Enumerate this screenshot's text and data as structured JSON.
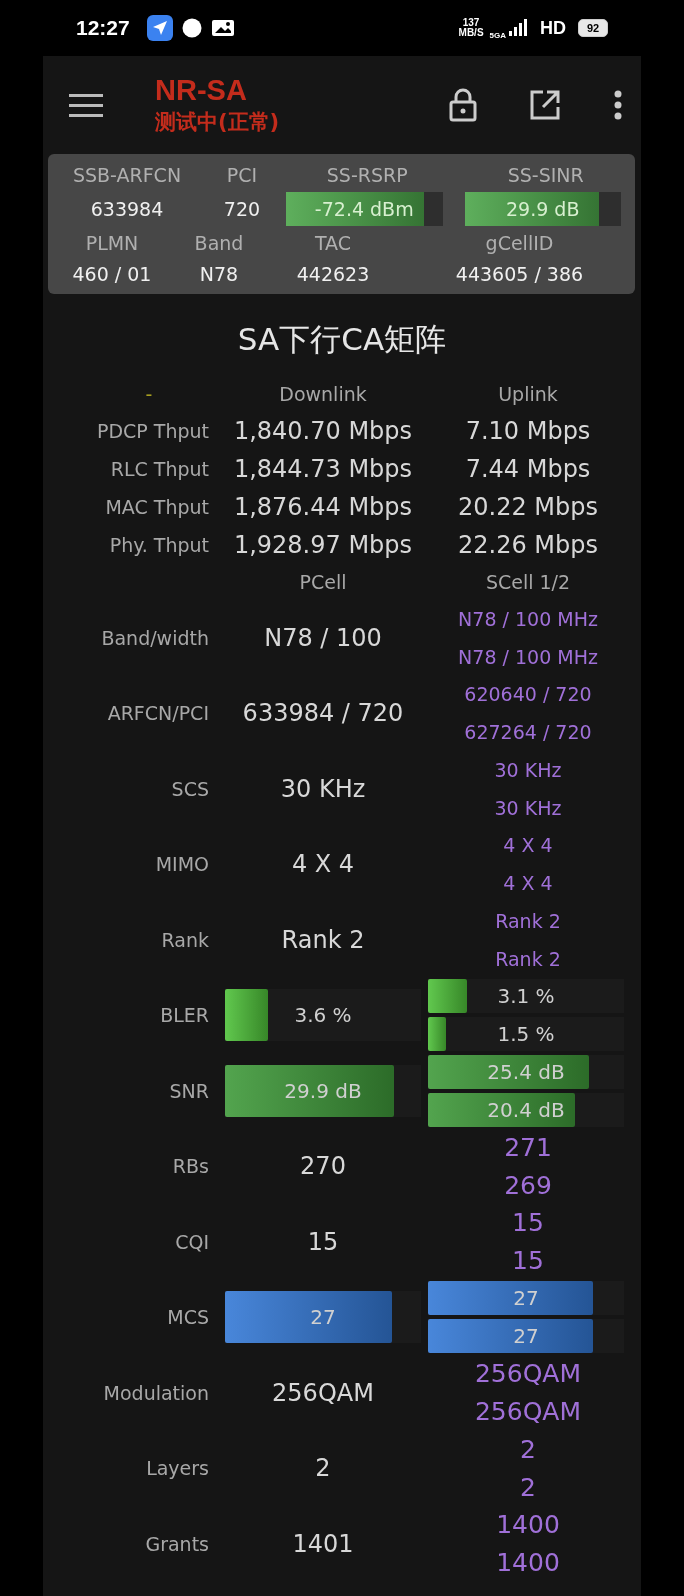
{
  "status_bar": {
    "time": "12:27",
    "net_speed": "137",
    "net_unit": "MB/S",
    "network": "5GA",
    "hd": "HD",
    "battery": "92"
  },
  "toolbar": {
    "title": "NR-SA",
    "subtitle": "测试中(正常)"
  },
  "serving": {
    "top": [
      {
        "label": "SSB-ARFCN",
        "value": "633984",
        "kind": "text"
      },
      {
        "label": "PCI",
        "value": "720",
        "kind": "text"
      },
      {
        "label": "SS-RSRP",
        "value": "-72.4 dBm",
        "kind": "meter",
        "level": 0.88
      },
      {
        "label": "SS-SINR",
        "value": "29.9 dB",
        "kind": "meter",
        "level": 0.86
      }
    ],
    "bottom": [
      {
        "label": "PLMN",
        "value": "460 / 01"
      },
      {
        "label": "Band",
        "value": "N78"
      },
      {
        "label": "TAC",
        "value": "442623"
      },
      {
        "label": "gCellID",
        "value": "443605 / 386"
      }
    ]
  },
  "ca_title": "SA下行CA矩阵",
  "throughput": {
    "corner": "-",
    "columns": [
      "Downlink",
      "Uplink"
    ],
    "rows": [
      {
        "label": "PDCP Thput",
        "downlink": "1,840.70 Mbps",
        "uplink": "7.10 Mbps"
      },
      {
        "label": "RLC Thput",
        "downlink": "1,844.73 Mbps",
        "uplink": "7.44 Mbps"
      },
      {
        "label": "MAC Thput",
        "downlink": "1,876.44 Mbps",
        "uplink": "20.22 Mbps"
      },
      {
        "label": "Phy. Thput",
        "downlink": "1,928.97 Mbps",
        "uplink": "22.26 Mbps"
      }
    ]
  },
  "cells": {
    "columns": [
      "PCell",
      "SCell 1/2"
    ],
    "rows": [
      {
        "label": "Band/width",
        "kind": "info",
        "pcell": {
          "value": "N78 / 100"
        },
        "scells": [
          {
            "value": "N78 / 100 MHz"
          },
          {
            "value": "N78 / 100 MHz"
          }
        ]
      },
      {
        "label": "ARFCN/PCI",
        "kind": "info",
        "pcell": {
          "value": "633984 / 720"
        },
        "scells": [
          {
            "value": "620640 / 720"
          },
          {
            "value": "627264 / 720"
          }
        ]
      },
      {
        "label": "SCS",
        "kind": "info",
        "pcell": {
          "value": "30 KHz"
        },
        "scells": [
          {
            "value": "30 KHz"
          },
          {
            "value": "30 KHz"
          }
        ]
      },
      {
        "label": "MIMO",
        "kind": "info",
        "pcell": {
          "value": "4 X 4"
        },
        "scells": [
          {
            "value": "4 X 4"
          },
          {
            "value": "4 X 4"
          }
        ]
      },
      {
        "label": "Rank",
        "kind": "info",
        "pcell": {
          "value": "Rank 2"
        },
        "scells": [
          {
            "value": "Rank 2"
          },
          {
            "value": "Rank 2"
          }
        ]
      },
      {
        "label": "BLER",
        "kind": "meter",
        "color": "#4fc23a",
        "pcell": {
          "value": "3.6 %",
          "level": 0.22
        },
        "scells": [
          {
            "value": "3.1 %",
            "level": 0.2
          },
          {
            "value": "1.5 %",
            "level": 0.09
          }
        ]
      },
      {
        "label": "SNR",
        "kind": "meter",
        "color": "#3f9a3a",
        "pcell": {
          "value": "29.9 dB",
          "level": 0.86
        },
        "scells": [
          {
            "value": "25.4 dB",
            "level": 0.82
          },
          {
            "value": "20.4 dB",
            "level": 0.75
          }
        ]
      },
      {
        "label": "RBs",
        "kind": "stat",
        "pcell": {
          "value": "270"
        },
        "scells": [
          {
            "value": "271"
          },
          {
            "value": "269"
          }
        ]
      },
      {
        "label": "CQI",
        "kind": "stat",
        "pcell": {
          "value": "15"
        },
        "scells": [
          {
            "value": "15"
          },
          {
            "value": "15"
          }
        ]
      },
      {
        "label": "MCS",
        "kind": "meter",
        "color": "#3479d6",
        "pcell": {
          "value": "27",
          "level": 0.85
        },
        "scells": [
          {
            "value": "27",
            "level": 0.84
          },
          {
            "value": "27",
            "level": 0.84
          }
        ]
      },
      {
        "label": "Modulation",
        "kind": "stat",
        "pcell": {
          "value": "256QAM"
        },
        "scells": [
          {
            "value": "256QAM"
          },
          {
            "value": "256QAM"
          }
        ]
      },
      {
        "label": "Layers",
        "kind": "stat",
        "pcell": {
          "value": "2"
        },
        "scells": [
          {
            "value": "2"
          },
          {
            "value": "2"
          }
        ]
      },
      {
        "label": "Grants",
        "kind": "stat",
        "pcell": {
          "value": "1401"
        },
        "scells": [
          {
            "value": "1400"
          },
          {
            "value": "1400"
          }
        ]
      }
    ]
  }
}
